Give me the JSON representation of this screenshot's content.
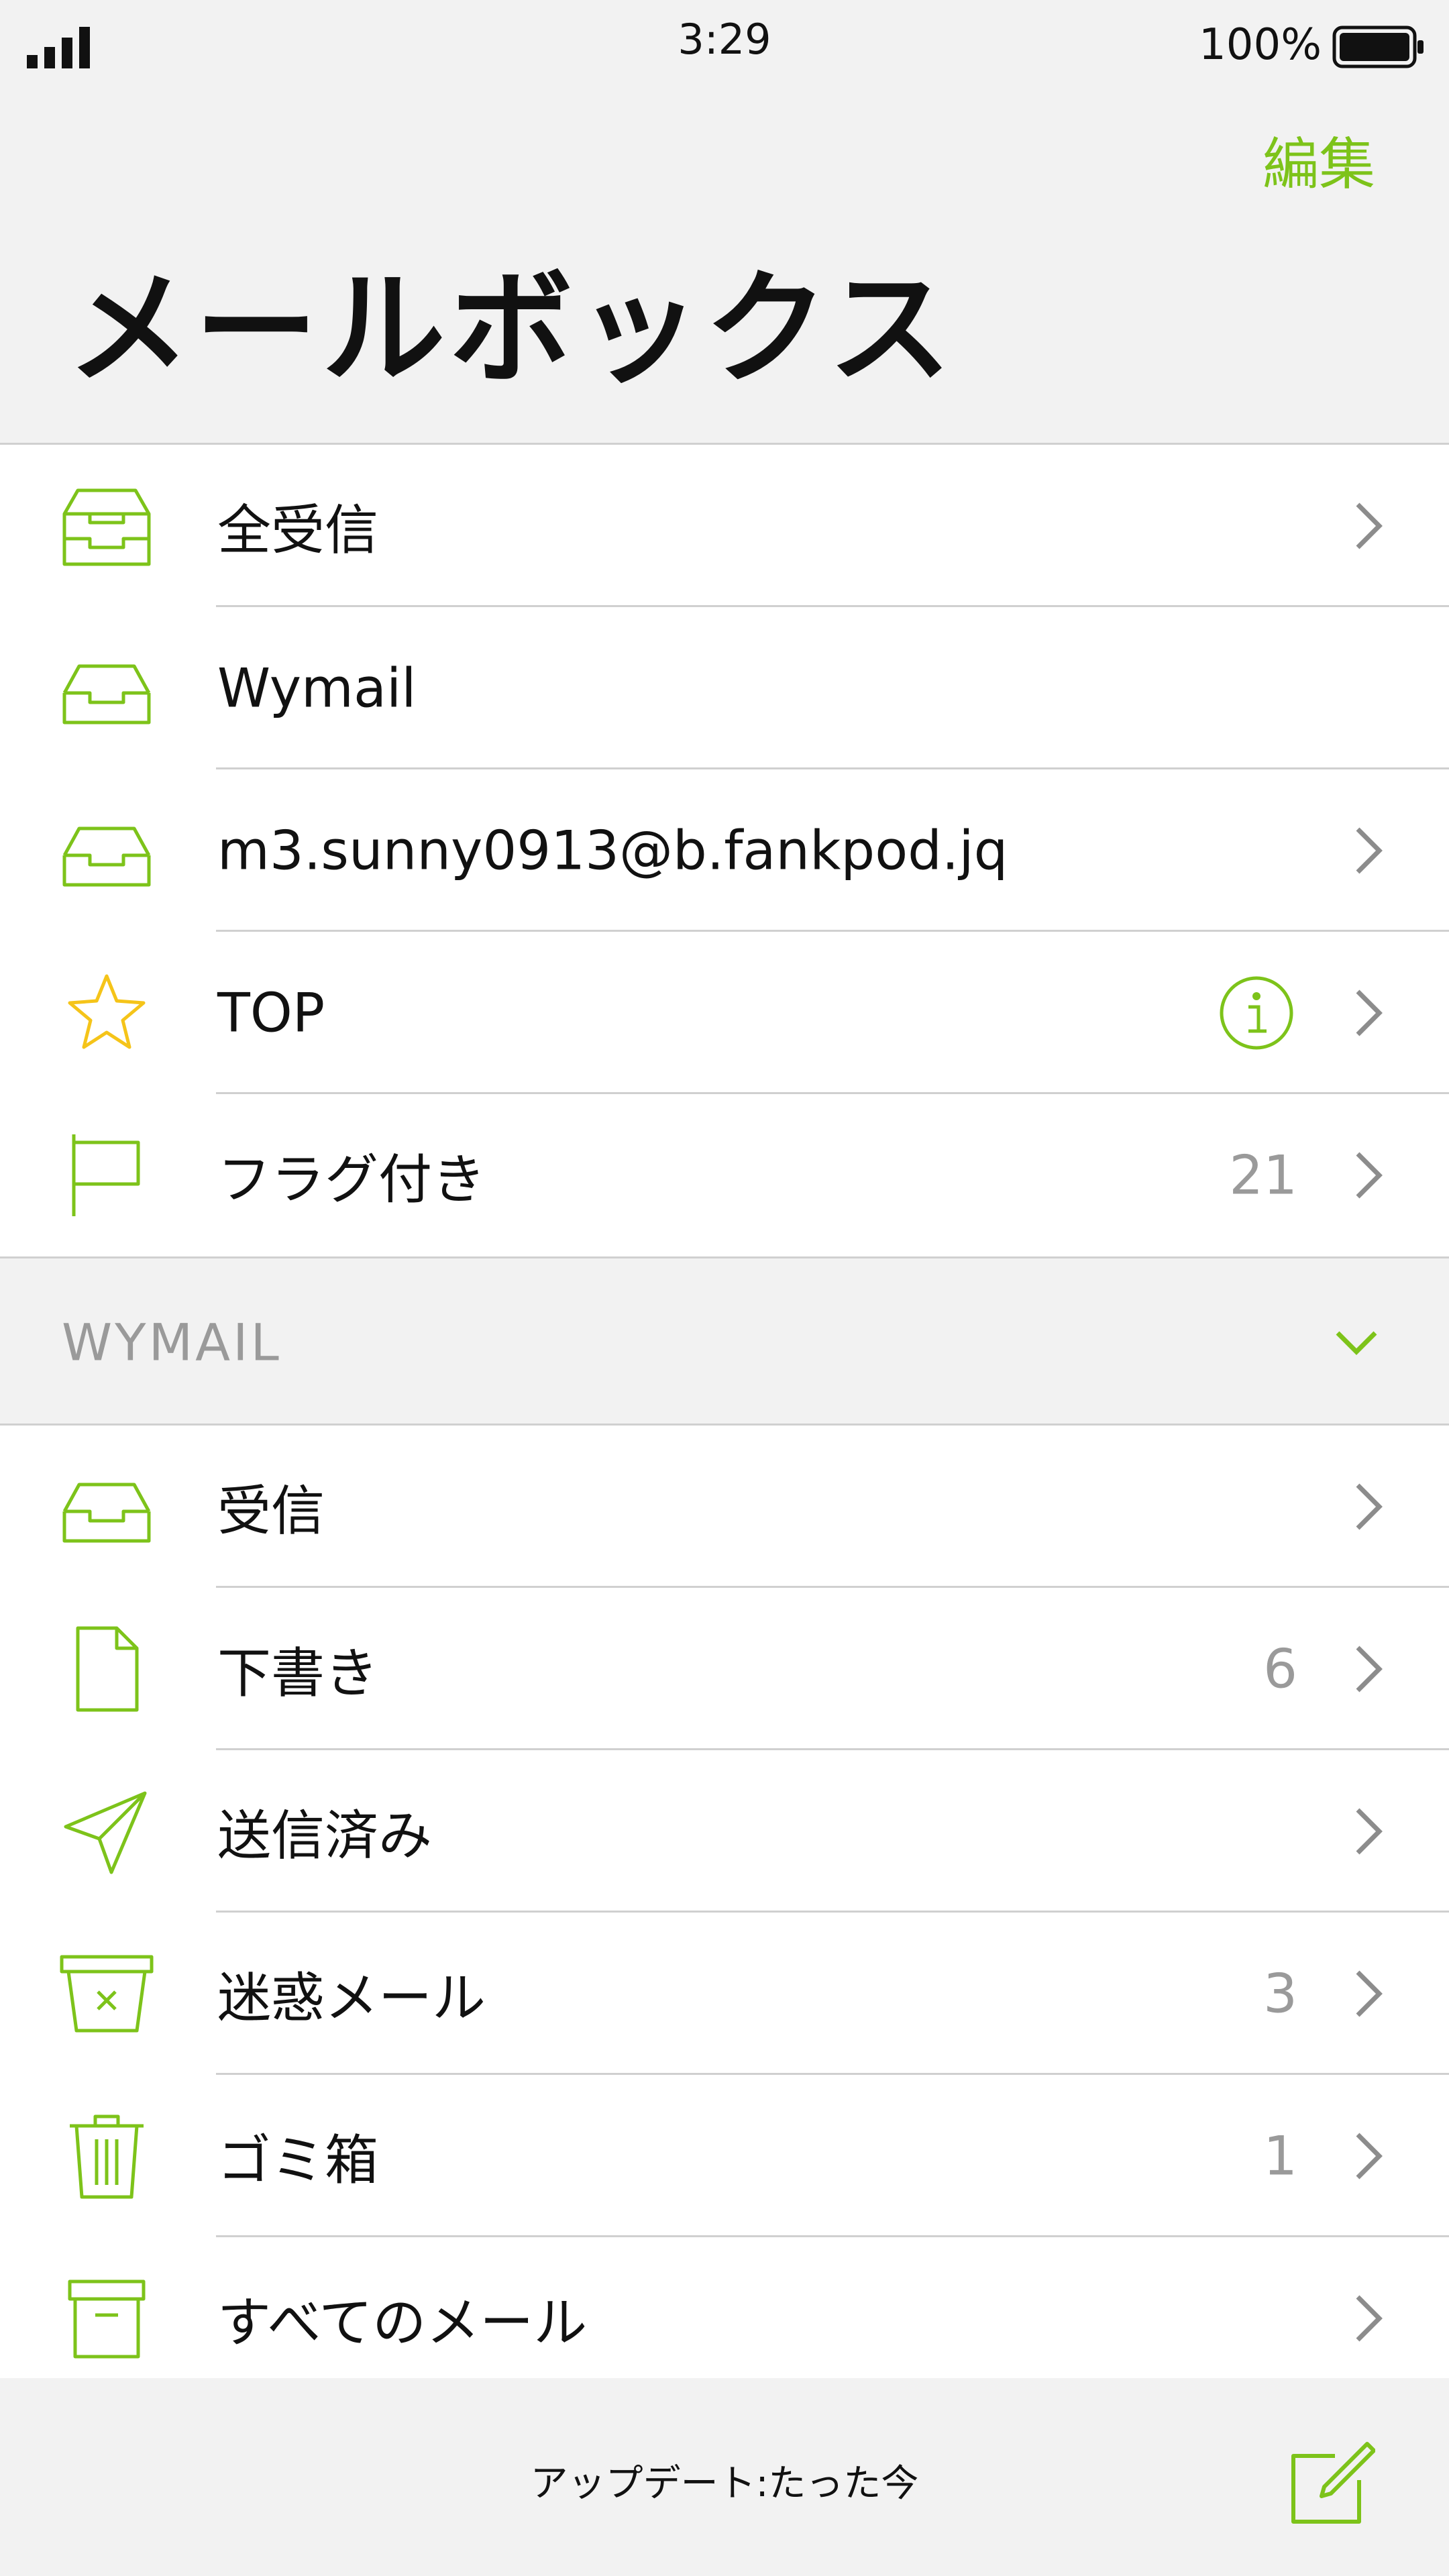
{
  "status_bar": {
    "time": "3:29",
    "battery_text": "100%"
  },
  "header": {
    "edit_label": "編集",
    "title": "メールボックス"
  },
  "top_list": {
    "items": [
      {
        "label": "全受信",
        "icon": "all-inbox-icon",
        "count": "",
        "chevron": true
      },
      {
        "label": "Wymail",
        "icon": "inbox-icon",
        "count": "",
        "chevron": false
      },
      {
        "label": "m3.sunny0913@b.fankpod.jq",
        "icon": "inbox-icon",
        "count": "",
        "chevron": true
      },
      {
        "label": "TOP",
        "icon": "star-icon",
        "count": "",
        "chevron": true,
        "info": true
      },
      {
        "label": "フラグ付き",
        "icon": "flag-icon",
        "count": "21",
        "chevron": true
      }
    ]
  },
  "section": {
    "title": "WYMAIL"
  },
  "wymail_list": {
    "items": [
      {
        "label": "受信",
        "icon": "inbox-icon",
        "count": "",
        "chevron": true
      },
      {
        "label": "下書き",
        "icon": "draft-icon",
        "count": "6",
        "chevron": true
      },
      {
        "label": "送信済み",
        "icon": "sent-icon",
        "count": "",
        "chevron": true
      },
      {
        "label": "迷惑メール",
        "icon": "junk-icon",
        "count": "3",
        "chevron": true
      },
      {
        "label": "ゴミ箱",
        "icon": "trash-icon",
        "count": "1",
        "chevron": true
      },
      {
        "label": "すべてのメール",
        "icon": "archive-icon",
        "count": "",
        "chevron": true
      }
    ]
  },
  "footer": {
    "update_text": "アップデート:たった今"
  },
  "colors": {
    "accent": "#7dc31a",
    "star": "#f5c419",
    "secondary_text": "#9a9a9a",
    "separator": "#d0d0d0"
  }
}
